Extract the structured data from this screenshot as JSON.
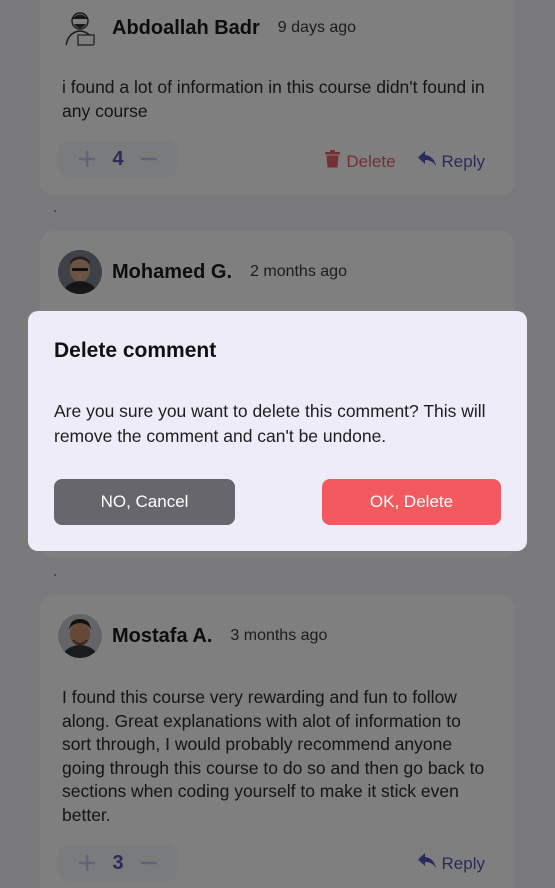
{
  "comments": [
    {
      "author": "Abdoallah Badr",
      "time": "9 days ago",
      "body": "i found a lot of information in this course didn't found in any course",
      "votes": "4",
      "delete_label": "Delete",
      "reply_label": "Reply"
    },
    {
      "author": "Mohamed G.",
      "time": "2 months ago"
    },
    {
      "author": "Mostafa A.",
      "time": "3 months ago",
      "body": "I found this course very rewarding and fun to follow along. Great explanations with alot of information to sort through, I would probably recommend anyone going through this course to do so and then go back to sections when coding yourself to make it stick even better.",
      "votes": "3",
      "reply_label": "Reply"
    }
  ],
  "modal": {
    "title": "Delete comment",
    "message": "Are you sure you want to delete this comment? This will remove the comment and can't be undone.",
    "cancel_label": "NO, Cancel",
    "confirm_label": "OK, Delete"
  },
  "colors": {
    "primary": "#5358b6",
    "danger": "#ed5e68",
    "cancel_button": "#67666d",
    "confirm_button": "#f35a5f",
    "modal_background": "#eeecf8"
  },
  "icons": [
    "plus-icon",
    "minus-icon",
    "trash-icon",
    "reply-icon"
  ]
}
